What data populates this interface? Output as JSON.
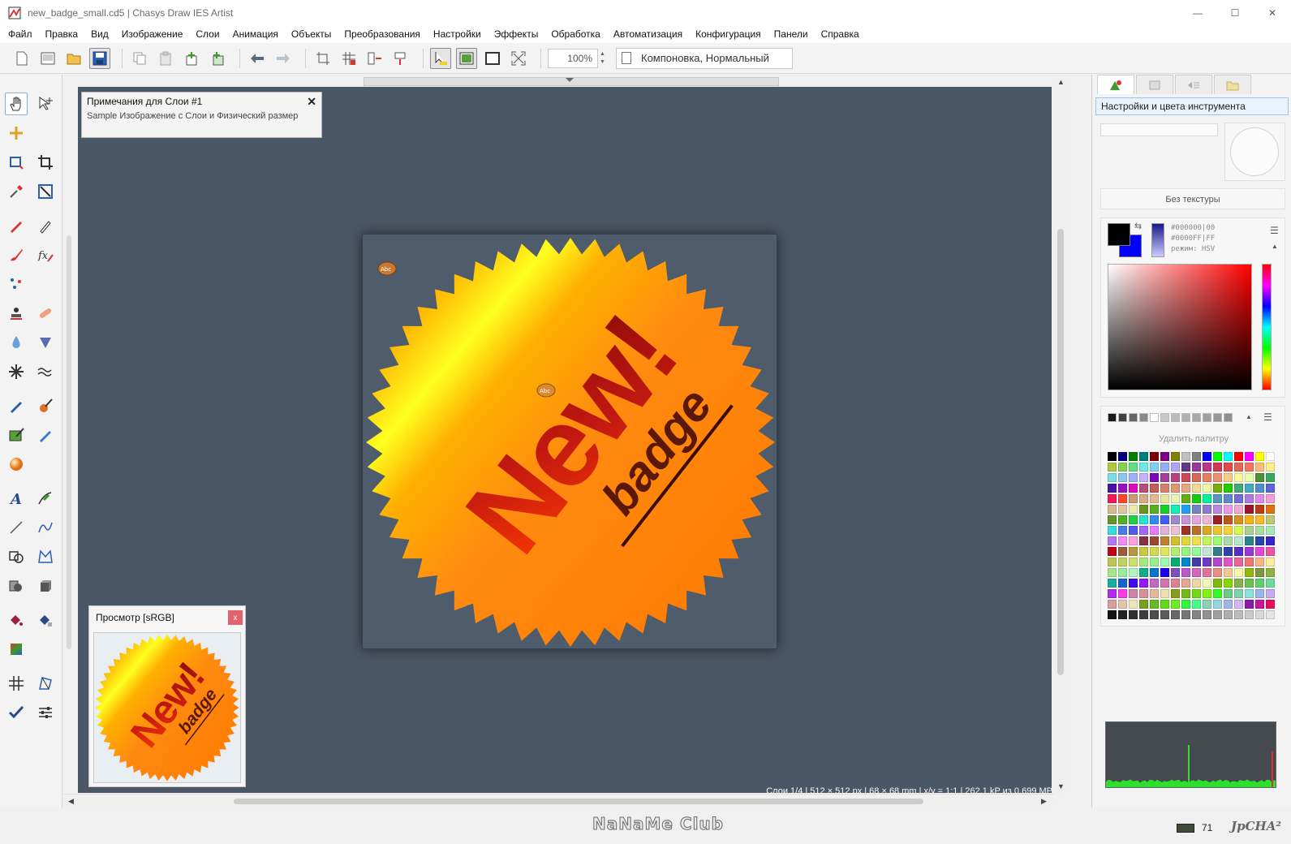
{
  "window": {
    "title": "new_badge_small.cd5 | Chasys Draw IES Artist",
    "minimize": "—",
    "maximize": "☐",
    "close": "✕"
  },
  "menu": [
    "Файл",
    "Правка",
    "Вид",
    "Изображение",
    "Слои",
    "Анимация",
    "Объекты",
    "Преобразования",
    "Настройки",
    "Эффекты",
    "Обработка",
    "Автоматизация",
    "Конфигурация",
    "Панели",
    "Справка"
  ],
  "toolbar": {
    "zoom": "100%",
    "layout_mode": "Компоновка, Нормальный"
  },
  "notes": {
    "title": "Примечания для Слои #1",
    "body": "Sample Изображение с Слои и Физический размер",
    "close": "✕"
  },
  "canvas": {
    "badge_main_text": "New!",
    "badge_sub_text": "badge",
    "note_marker_text": "Abc"
  },
  "preview": {
    "title": "Просмотр [sRGB]",
    "close": "x"
  },
  "status": {
    "info": "Слои 1/4 | 512 × 512 px | 68 × 68 mm | x/y = 1:1 | 262.1 kP из 0.699 MP"
  },
  "bottom": {
    "watermark": "NaNaMe Club",
    "fps": "71",
    "brand": "JpCHA²"
  },
  "right_panel": {
    "heading": "Настройки и цвета инструмента",
    "texture": "Без текстуры",
    "color_line1": "#000000|00",
    "color_line2": "#0000FF|FF",
    "color_line3": "режим: HSV",
    "palette_label": "Удалить палитру",
    "fg_color": "#000000",
    "bg_color": "#0000FF"
  }
}
